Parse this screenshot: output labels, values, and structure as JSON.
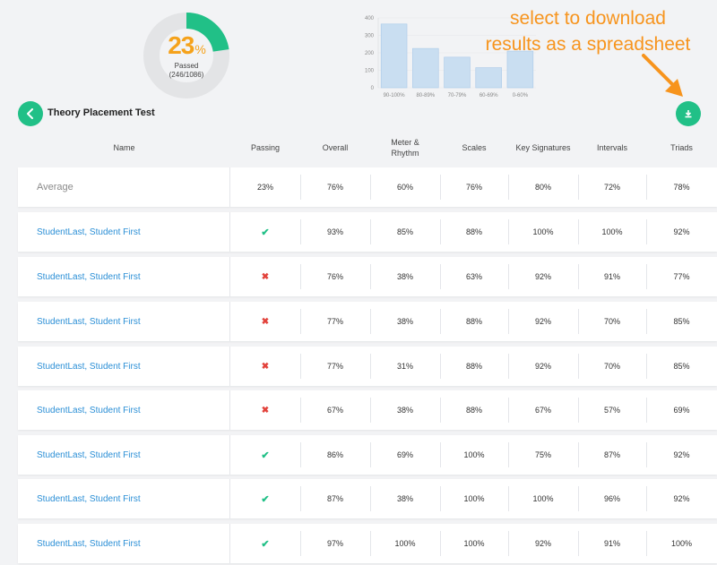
{
  "summary": {
    "percent": "23",
    "percent_sign": "%",
    "passed_label": "Passed",
    "passed_count": "(246/1086)",
    "pass_fraction": 0.2265,
    "ring_color": "#21c087",
    "track_color": "#e3e4e6"
  },
  "histogram": {
    "y_ticks": [
      "400",
      "300",
      "200",
      "100",
      "0"
    ],
    "categories": [
      "90-100%",
      "80-89%",
      "70-79%",
      "60-69%",
      "0-60%"
    ],
    "values": [
      365,
      225,
      175,
      115,
      210
    ],
    "ymax": 400
  },
  "annotation": {
    "line1": "select to download",
    "line2": "results as a spreadsheet",
    "color": "#f7941d"
  },
  "header": {
    "back_icon": "chevron-left-icon",
    "title": "Theory Placement Test",
    "download_icon": "download-icon"
  },
  "columns": [
    "Name",
    "Passing",
    "Overall",
    "Meter &\nRhythm",
    "Scales",
    "Key Signatures",
    "Intervals",
    "Triads"
  ],
  "average_row": {
    "name": "Average",
    "passing": "23%",
    "values": [
      "76%",
      "60%",
      "76%",
      "80%",
      "72%",
      "78%"
    ]
  },
  "students": [
    {
      "name": "StudentLast, Student First",
      "passed": true,
      "values": [
        "93%",
        "85%",
        "88%",
        "100%",
        "100%",
        "92%"
      ]
    },
    {
      "name": "StudentLast, Student First",
      "passed": false,
      "values": [
        "76%",
        "38%",
        "63%",
        "92%",
        "91%",
        "77%"
      ]
    },
    {
      "name": "StudentLast, Student First",
      "passed": false,
      "values": [
        "77%",
        "38%",
        "88%",
        "92%",
        "70%",
        "85%"
      ]
    },
    {
      "name": "StudentLast, Student First",
      "passed": false,
      "values": [
        "77%",
        "31%",
        "88%",
        "92%",
        "70%",
        "85%"
      ]
    },
    {
      "name": "StudentLast, Student First",
      "passed": false,
      "values": [
        "67%",
        "38%",
        "88%",
        "67%",
        "57%",
        "69%"
      ]
    },
    {
      "name": "StudentLast, Student First",
      "passed": true,
      "values": [
        "86%",
        "69%",
        "100%",
        "75%",
        "87%",
        "92%"
      ]
    },
    {
      "name": "StudentLast, Student First",
      "passed": true,
      "values": [
        "87%",
        "38%",
        "100%",
        "100%",
        "96%",
        "92%"
      ]
    },
    {
      "name": "StudentLast, Student First",
      "passed": true,
      "values": [
        "97%",
        "100%",
        "100%",
        "92%",
        "91%",
        "100%"
      ]
    }
  ],
  "marks": {
    "check": "✔",
    "cross": "✖"
  },
  "colors": {
    "accent": "#21c087",
    "link": "#2b8fd6",
    "fail": "#e2423b",
    "highlight": "#f5a21b"
  }
}
